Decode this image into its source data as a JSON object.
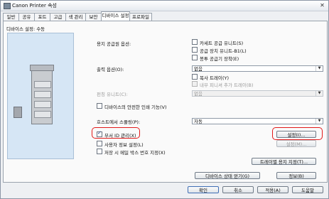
{
  "window": {
    "title": "Canon Printer 속성",
    "close": "✕"
  },
  "tabs": [
    "일반",
    "공유",
    "포트",
    "고급",
    "색 관리",
    "보안",
    "디바이스 설정",
    "프로파일"
  ],
  "panel": {
    "heading": "디바이스 설정: 수동",
    "paper_source_label": "용지 공급원 옵션:",
    "paper_source_opts": [
      "카세트 공급 유니트(S)",
      "공급 장치 유니트-B1(L)",
      "봉투 공급기 장착(E)"
    ],
    "output_label": "출력 옵션(O):",
    "output_value": "없음",
    "output_opts": [
      "복사 트레이(Y)",
      "내부 피니셔 추가 트레이(B)"
    ],
    "punch_label": "펀칭 유니트(C):",
    "punch_value": "없음",
    "secure_print": "디바이스의 안전한 인쇄 기능(V)",
    "spool_label": "호스트에서 스풀링(P):",
    "spool_value": "자동",
    "dept_id": "부서 ID 관리(X)",
    "user_info": "사용자 정보 설정(L)",
    "save_box": "저장 시 메일 박스 번호 지정(X)",
    "btn_settings": "설정(I)...",
    "btn_settings2": "설정(M)...",
    "btn_tray": "트레이별 용지 지정(T)...",
    "btn_get_info": "디바이스 상태 얻기(G)",
    "btn_info": "정보(B)"
  },
  "footer": {
    "ok": "확인",
    "cancel": "취소",
    "apply": "적용(A)",
    "help": "도움말"
  }
}
